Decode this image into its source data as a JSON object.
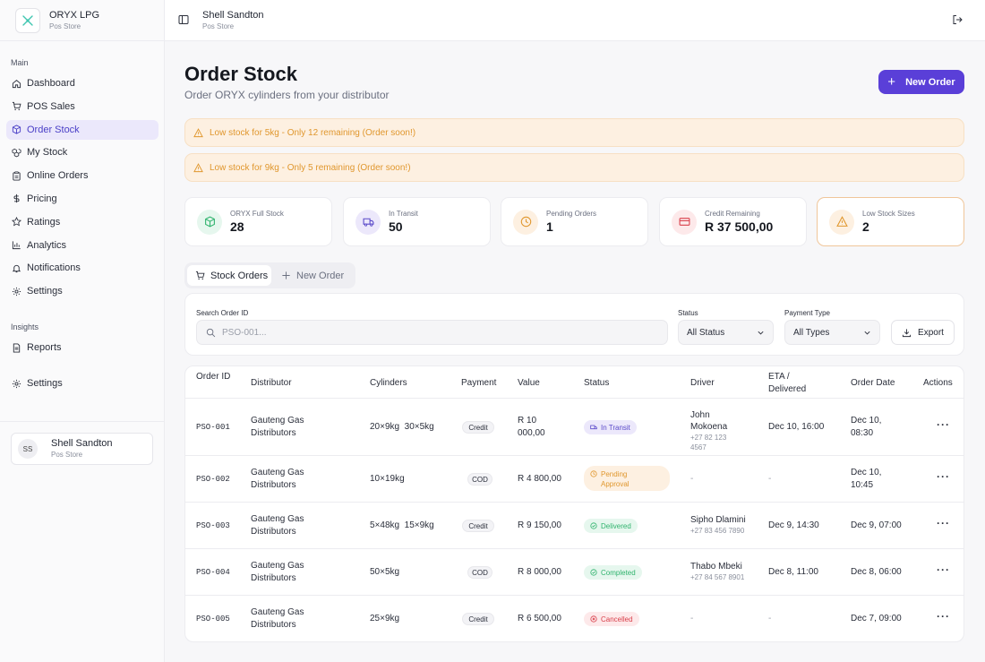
{
  "brand": {
    "title": "ORYX LPG",
    "subtitle": "Pos Store"
  },
  "sidebar": {
    "main_label": "Main",
    "items": [
      {
        "label": "Dashboard",
        "icon": "home-icon"
      },
      {
        "label": "POS Sales",
        "icon": "cart-icon"
      },
      {
        "label": "Order Stock",
        "icon": "box-icon",
        "active": true
      },
      {
        "label": "My Stock",
        "icon": "boxes-icon"
      },
      {
        "label": "Online Orders",
        "icon": "clipboard-icon"
      },
      {
        "label": "Pricing",
        "icon": "dollar-icon"
      },
      {
        "label": "Ratings",
        "icon": "star-icon"
      },
      {
        "label": "Analytics",
        "icon": "chart-icon"
      },
      {
        "label": "Notifications",
        "icon": "bell-icon"
      },
      {
        "label": "Settings",
        "icon": "gear-icon"
      }
    ],
    "insights_label": "Insights",
    "insights_items": [
      {
        "label": "Reports",
        "icon": "document-icon"
      },
      {
        "label": "Settings",
        "icon": "gear-icon"
      }
    ],
    "user": {
      "initials": "SS",
      "name": "Shell Sandton",
      "role": "Pos Store"
    }
  },
  "topbar": {
    "title": "Shell Sandton",
    "subtitle": "Pos Store"
  },
  "page": {
    "title": "Order Stock",
    "subtitle": "Order ORYX cylinders from your distributor",
    "new_order_label": "New Order"
  },
  "alerts": [
    "Low stock for 5kg - Only 12 remaining (Order soon!)",
    "Low stock for 9kg - Only 5 remaining (Order soon!)"
  ],
  "stats": [
    {
      "label": "ORYX Full Stock",
      "value": "28",
      "icon": "cube-icon",
      "color": "#2fb36d",
      "bg": "#e6f7ee"
    },
    {
      "label": "In Transit",
      "value": "50",
      "icon": "truck-icon",
      "color": "#5a49c9",
      "bg": "#ece8fb"
    },
    {
      "label": "Pending Orders",
      "value": "1",
      "icon": "clock-icon",
      "color": "#e0972e",
      "bg": "#fdf0e1"
    },
    {
      "label": "Credit Remaining",
      "value": "R 37 500,00",
      "icon": "credit-card-icon",
      "color": "#d9404b",
      "bg": "#fde9ea"
    },
    {
      "label": "Low Stock Sizes",
      "value": "2",
      "icon": "warning-icon",
      "color": "#e0972e",
      "bg": "#fdf0e1"
    }
  ],
  "tabs": {
    "stock_orders": "Stock Orders",
    "new_order": "New Order"
  },
  "filters": {
    "search_label": "Search Order ID",
    "search_placeholder": "PSO-001...",
    "status_label": "Status",
    "status_value": "All Status",
    "payment_label": "Payment Type",
    "payment_value": "All Types",
    "export_label": "Export"
  },
  "table": {
    "headers": {
      "order_id": "Order ID",
      "distributor": "Distributor",
      "cylinders": "Cylinders",
      "payment": "Payment",
      "value": "Value",
      "status": "Status",
      "driver": "Driver",
      "eta": "ETA / Delivered",
      "order_date": "Order Date",
      "actions": "Actions"
    },
    "rows": [
      {
        "id": "PSO-001",
        "distributor": "Gauteng Gas Distributors",
        "cylinders": "20×9kg  30×5kg",
        "payment": "Credit",
        "value": "R 10 000,00",
        "status": "In Transit",
        "driver": "John Mokoena",
        "phone": "+27 82 123 4567",
        "eta": "Dec 10, 16:00",
        "order_date": "Dec 10, 08:30"
      },
      {
        "id": "PSO-002",
        "distributor": "Gauteng Gas Distributors",
        "cylinders": "10×19kg",
        "payment": "COD",
        "value": "R 4 800,00",
        "status": "Pending Approval",
        "driver": "-",
        "phone": "",
        "eta": "-",
        "order_date": "Dec 10, 10:45"
      },
      {
        "id": "PSO-003",
        "distributor": "Gauteng Gas Distributors",
        "cylinders": "5×48kg  15×9kg",
        "payment": "Credit",
        "value": "R 9 150,00",
        "status": "Delivered",
        "driver": "Sipho Dlamini",
        "phone": "+27 83 456 7890",
        "eta": "Dec 9, 14:30",
        "order_date": "Dec 9, 07:00"
      },
      {
        "id": "PSO-004",
        "distributor": "Gauteng Gas Distributors",
        "cylinders": "50×5kg",
        "payment": "COD",
        "value": "R 8 000,00",
        "status": "Completed",
        "driver": "Thabo Mbeki",
        "phone": "+27 84 567 8901",
        "eta": "Dec 8, 11:00",
        "order_date": "Dec 8, 06:00"
      },
      {
        "id": "PSO-005",
        "distributor": "Gauteng Gas Distributors",
        "cylinders": "25×9kg",
        "payment": "Credit",
        "value": "R 6 500,00",
        "status": "Cancelled",
        "driver": "-",
        "phone": "",
        "eta": "-",
        "order_date": "Dec 7, 09:00"
      }
    ],
    "actions_glyph": "···"
  }
}
